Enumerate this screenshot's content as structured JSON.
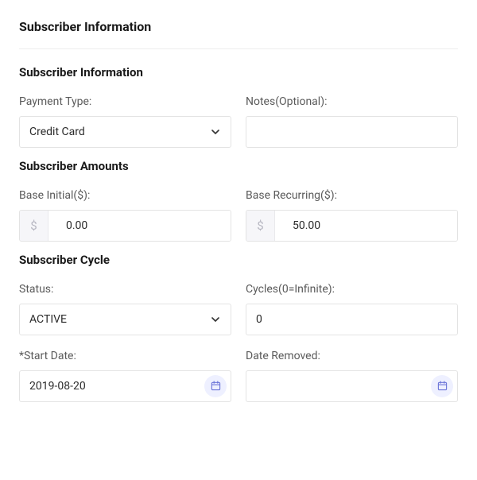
{
  "page_title": "Subscriber Information",
  "sections": {
    "info": {
      "title": "Subscriber Information",
      "payment_type": {
        "label": "Payment Type:",
        "value": "Credit Card"
      },
      "notes": {
        "label": "Notes(Optional):",
        "value": ""
      }
    },
    "amounts": {
      "title": "Subscriber Amounts",
      "base_initial": {
        "label": "Base Initial($):",
        "value": "0.00",
        "prefix": "$"
      },
      "base_recurring": {
        "label": "Base Recurring($):",
        "value": "50.00",
        "prefix": "$"
      }
    },
    "cycle": {
      "title": "Subscriber Cycle",
      "status": {
        "label": "Status:",
        "value": "ACTIVE"
      },
      "cycles": {
        "label": "Cycles(0=Infinite):",
        "value": "0"
      },
      "start_date": {
        "label": "*Start Date:",
        "value": "2019-08-20"
      },
      "date_removed": {
        "label": "Date Removed:",
        "value": ""
      }
    }
  }
}
